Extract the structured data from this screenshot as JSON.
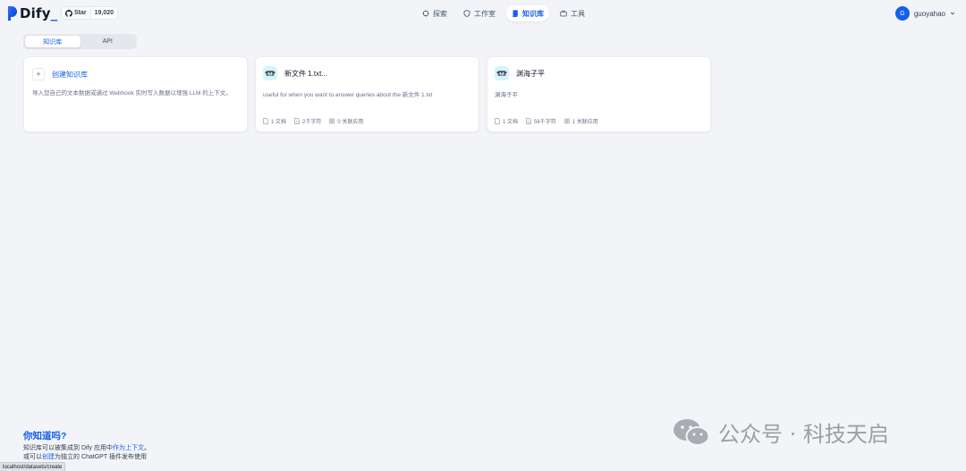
{
  "header": {
    "logo_text": "Dify",
    "github": {
      "label": "Star",
      "count": "19,020"
    },
    "nav": [
      {
        "label": "探索",
        "icon": "compass-icon"
      },
      {
        "label": "工作室",
        "icon": "shield-icon"
      },
      {
        "label": "知识库",
        "icon": "book-icon",
        "active": true
      },
      {
        "label": "工具",
        "icon": "briefcase-icon"
      }
    ],
    "user": {
      "initial": "G",
      "name": "guoyahao"
    }
  },
  "tabs": [
    {
      "label": "知识库",
      "active": true
    },
    {
      "label": "API",
      "active": false
    }
  ],
  "create_card": {
    "title": "创建知识库",
    "description": "导入您自己的文本数据或通过 Webhook 实时写入数据以增强 LLM 的上下文。"
  },
  "datasets": [
    {
      "title": "新文件 1.txt...",
      "description": "useful for when you want to answer queries about the 新文件 1.txt",
      "docs": "1 文档",
      "chars": "2千字符",
      "apps": "0 关联应用"
    },
    {
      "title": "渊海子平",
      "description": "渊海子平",
      "docs": "1 文档",
      "chars": "56千字符",
      "apps": "1 关联应用"
    }
  ],
  "tip": {
    "title": "你知道吗?",
    "line1_a": "知识库可以被集成到 Dify 应用中",
    "line1_link": "作为上下文",
    "line1_b": "。",
    "line2_a": "或可以",
    "line2_link": "创建",
    "line2_b": "为独立的 ChatGPT 插件发布使用"
  },
  "status_url": "localhost/datasets/create",
  "watermark": "公众号 · 科技天启",
  "colors": {
    "accent": "#155eef",
    "background": "#f2f4f7",
    "dataset_icon_bg": "#d5f5f6"
  }
}
